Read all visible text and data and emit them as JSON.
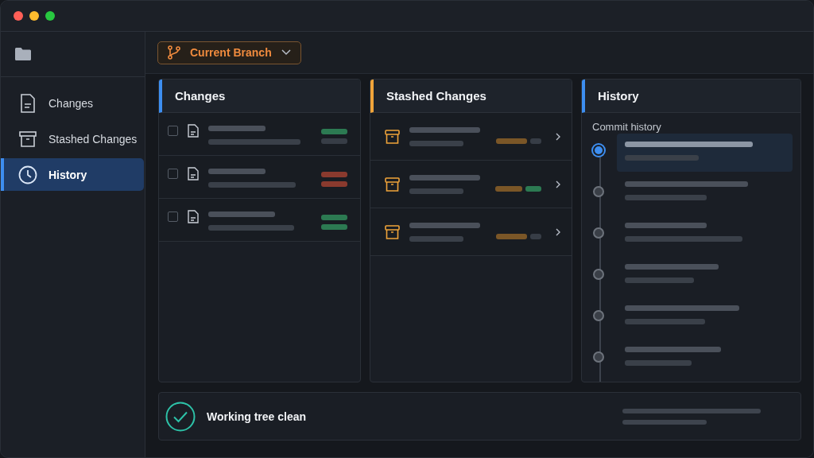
{
  "sidebar": {
    "items": [
      {
        "kind": "changes",
        "label": "Changes",
        "selected": false
      },
      {
        "kind": "stash",
        "label": "Stashed Changes",
        "selected": false
      },
      {
        "kind": "history",
        "label": "History",
        "selected": true
      }
    ]
  },
  "branch": {
    "label": "Current Branch"
  },
  "changes": {
    "title": "Changes",
    "files": [
      {
        "checked": false,
        "tags": [
          {
            "color": "#2c7a52"
          },
          {
            "color": "#373d46"
          }
        ]
      },
      {
        "checked": false,
        "tags": [
          {
            "color": "#8a3a2e"
          },
          {
            "color": "#8a3a2e"
          }
        ]
      },
      {
        "checked": false,
        "tags": [
          {
            "color": "#2c7a52"
          },
          {
            "color": "#2c7a52"
          }
        ]
      }
    ]
  },
  "stash": {
    "title": "Stashed Changes",
    "stashes": [
      {
        "tags": [
          {
            "color": "#7a5627"
          },
          {
            "color": "#373d46"
          }
        ]
      },
      {
        "tags": [
          {
            "color": "#7a5627"
          },
          {
            "color": "#2c7a52"
          }
        ]
      },
      {
        "tags": [
          {
            "color": "#7a5627"
          },
          {
            "color": "#373d46"
          }
        ]
      }
    ]
  },
  "history": {
    "title": "History",
    "subtitle": "Commit history",
    "commits": [
      {
        "selected": true
      },
      {
        "selected": false
      },
      {
        "selected": false
      },
      {
        "selected": false
      },
      {
        "selected": false
      },
      {
        "selected": false
      }
    ]
  },
  "status": {
    "text": "Working tree clean"
  }
}
